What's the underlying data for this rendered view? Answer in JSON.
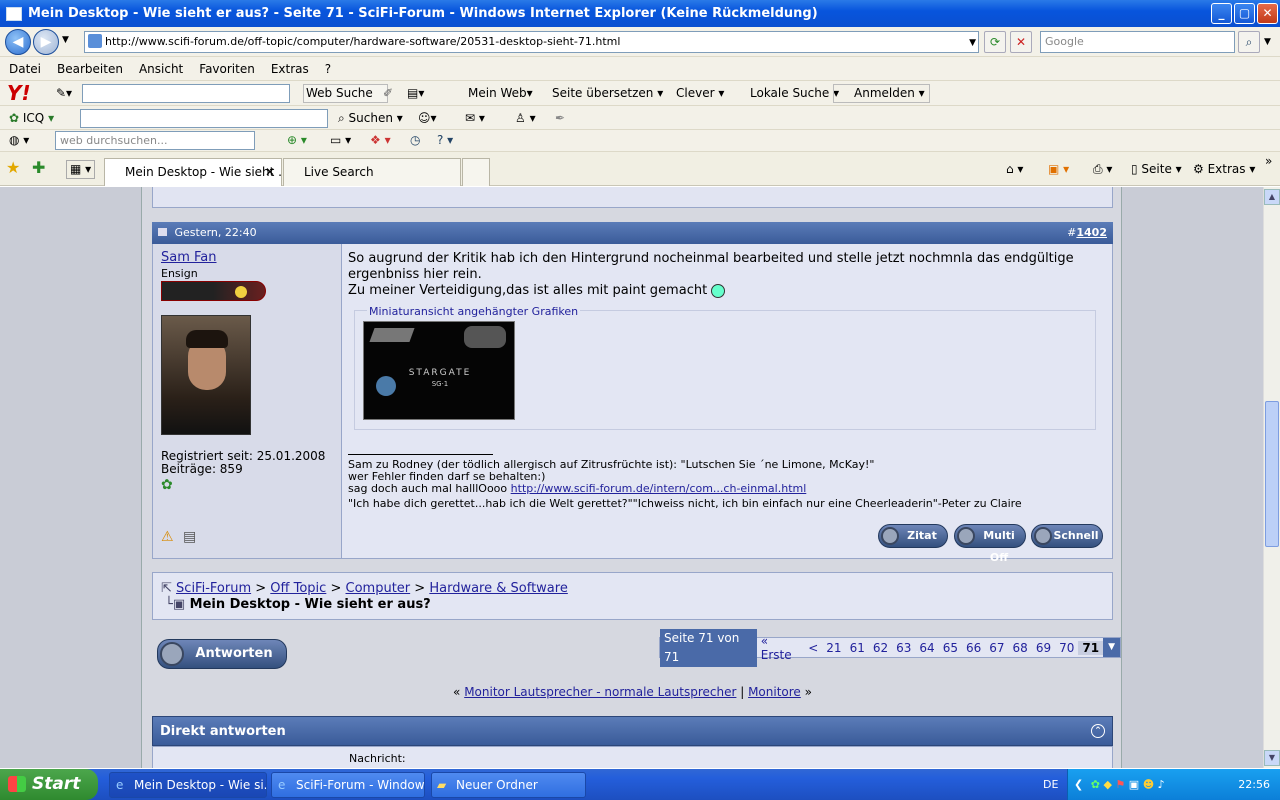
{
  "window": {
    "title": "Mein Desktop - Wie sieht er aus? - Seite 71 - SciFi-Forum - Windows Internet Explorer (Keine Rückmeldung)"
  },
  "address": {
    "url": "http://www.scifi-forum.de/off-topic/computer/hardware-software/20531-desktop-sieht-71.html",
    "search_placeholder": "Google"
  },
  "menu": [
    "Datei",
    "Bearbeiten",
    "Ansicht",
    "Favoriten",
    "Extras",
    "?"
  ],
  "yahoo_toolbar": {
    "web_search": "Web Suche",
    "mein_web": "Mein Web",
    "translate": "Seite übersetzen",
    "clever": "Clever",
    "local": "Lokale Suche",
    "login": "Anmelden"
  },
  "icq_toolbar": {
    "icq": "ICQ",
    "search": "Suchen"
  },
  "third_toolbar": {
    "placeholder": "web durchsuchen..."
  },
  "tabs": [
    {
      "label": "Mein Desktop - Wie sieht ..."
    },
    {
      "label": "Live Search"
    }
  ],
  "command_bar": {
    "page": "Seite",
    "extras": "Extras"
  },
  "post": {
    "date": "Gestern, 22:40",
    "number_prefix": "#",
    "number": "1402",
    "username": "Sam Fan",
    "rank": "Ensign",
    "registered": "Registriert seit: 25.01.2008",
    "posts": "Beiträge: 859",
    "text1": "So augrund der Kritik hab ich den Hintergrund nocheinmal bearbeited und stelle jetzt nochmnla das endgültige ergenbniss hier rein.",
    "text2": "Zu meiner Verteidigung,das ist alles mit paint gemacht",
    "attachment_legend": "Miniaturansicht angehängter Grafiken",
    "thumb_text": "STARGATE",
    "thumb_sub": "SG·1",
    "sig1": "Sam zu Rodney (der tödlich allergisch auf Zitrusfrüchte ist): \"Lutschen Sie ´ne Limone, McKay!\"",
    "sig2": "wer Fehler finden darf se behalten:)",
    "sig3_prefix": "sag doch auch mal halllOooo ",
    "sig3_link": "http://www.scifi-forum.de/intern/com...ch-einmal.html",
    "sig4": "\"Ich habe dich gerettet...hab ich die Welt gerettet?\"\"Ichweiss nicht, ich bin einfach nur eine Cheerleaderin\"-Peter zu Claire",
    "btn_quote": "Zitat",
    "btn_multi": "Multi Off",
    "btn_quick": "Schnell"
  },
  "breadcrumb": {
    "items": [
      "SciFi-Forum",
      "Off Topic",
      "Computer",
      "Hardware & Software"
    ],
    "sep": ">",
    "current": "Mein Desktop - Wie sieht er aus?"
  },
  "reply_button": "Antworten",
  "pagination": {
    "label": "Seite 71 von 71",
    "first": "« Erste",
    "prev": "<",
    "pages": [
      "21",
      "61",
      "62",
      "63",
      "64",
      "65",
      "66",
      "67",
      "68",
      "69",
      "70"
    ],
    "current": "71"
  },
  "thread_nav": {
    "prev_link": "Monitor Lautsprecher - normale Lautsprecher",
    "next_link": "Monitore"
  },
  "quick_reply": {
    "title": "Direkt antworten",
    "sub": "Nachricht:"
  },
  "taskbar": {
    "start": "Start",
    "tasks": [
      "Mein Desktop - Wie si...",
      "SciFi-Forum - Window...",
      "Neuer Ordner"
    ],
    "lang": "DE",
    "clock": "22:56"
  }
}
